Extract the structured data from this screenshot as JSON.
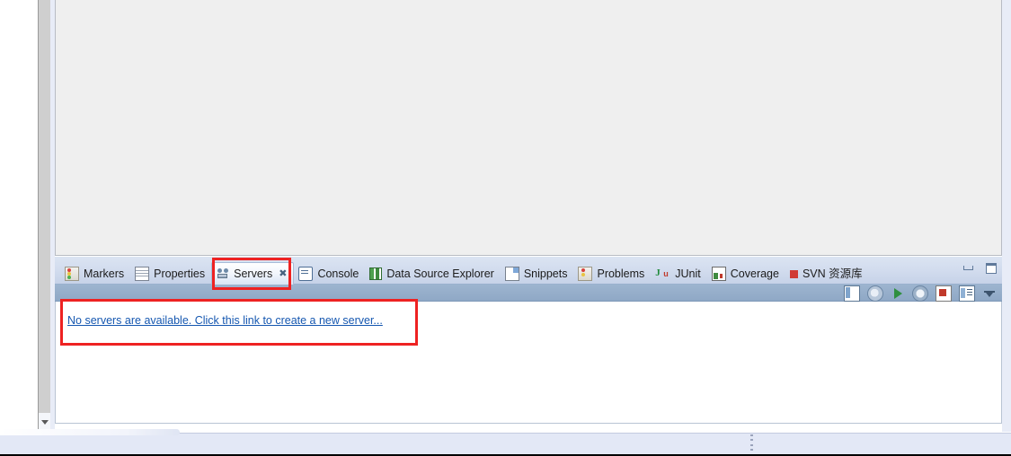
{
  "workbench": {
    "editor_area": {
      "content": ""
    },
    "scrollbar": {
      "down_arrow_icon": "chevron-down-icon"
    }
  },
  "view_stack": {
    "tabs": [
      {
        "label": "Markers",
        "icon": "markers-icon",
        "active": false,
        "closable": false
      },
      {
        "label": "Properties",
        "icon": "properties-icon",
        "active": false,
        "closable": false
      },
      {
        "label": "Servers",
        "icon": "servers-icon",
        "active": true,
        "closable": true,
        "close_glyph": "✖"
      },
      {
        "label": "Console",
        "icon": "console-icon",
        "active": false,
        "closable": false
      },
      {
        "label": "Data Source Explorer",
        "icon": "data-source-explorer-icon",
        "active": false,
        "closable": false
      },
      {
        "label": "Snippets",
        "icon": "snippets-icon",
        "active": false,
        "closable": false
      },
      {
        "label": "Problems",
        "icon": "problems-icon",
        "active": false,
        "closable": false
      },
      {
        "label": "JUnit",
        "icon": "junit-icon",
        "active": false,
        "closable": false,
        "icon_text_primary": "J",
        "icon_text_secondary": "u"
      },
      {
        "label": "Coverage",
        "icon": "coverage-icon",
        "active": false,
        "closable": false
      },
      {
        "label": "SVN 资源库",
        "icon": "svn-repository-icon",
        "active": false,
        "closable": false
      }
    ],
    "window_controls": [
      {
        "name": "minimize-view-button",
        "tooltip": "Minimize"
      },
      {
        "name": "maximize-view-button",
        "tooltip": "Maximize"
      }
    ],
    "toolbar_icons": [
      {
        "name": "show-server-configuration-icon"
      },
      {
        "name": "debug-server-icon"
      },
      {
        "name": "start-server-icon"
      },
      {
        "name": "profile-server-icon"
      },
      {
        "name": "stop-server-icon"
      },
      {
        "name": "publish-to-server-icon"
      },
      {
        "name": "view-menu-icon"
      }
    ],
    "body": {
      "link_text": "No servers are available. Click this link to create a new server...",
      "link_color": "#1557b0"
    }
  },
  "annotations": [
    {
      "name": "servers-tab-highlight",
      "color": "#ee2222"
    },
    {
      "name": "no-servers-link-highlight",
      "color": "#ee2222"
    }
  ],
  "status_bar": {
    "text": ""
  }
}
